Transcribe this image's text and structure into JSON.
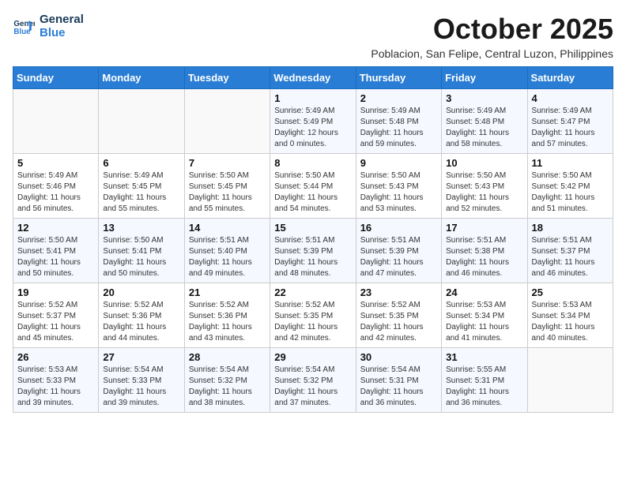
{
  "logo": {
    "line1": "General",
    "line2": "Blue"
  },
  "header": {
    "month_year": "October 2025",
    "location": "Poblacion, San Felipe, Central Luzon, Philippines"
  },
  "weekdays": [
    "Sunday",
    "Monday",
    "Tuesday",
    "Wednesday",
    "Thursday",
    "Friday",
    "Saturday"
  ],
  "weeks": [
    [
      {
        "day": "",
        "info": ""
      },
      {
        "day": "",
        "info": ""
      },
      {
        "day": "",
        "info": ""
      },
      {
        "day": "1",
        "info": "Sunrise: 5:49 AM\nSunset: 5:49 PM\nDaylight: 12 hours\nand 0 minutes."
      },
      {
        "day": "2",
        "info": "Sunrise: 5:49 AM\nSunset: 5:48 PM\nDaylight: 11 hours\nand 59 minutes."
      },
      {
        "day": "3",
        "info": "Sunrise: 5:49 AM\nSunset: 5:48 PM\nDaylight: 11 hours\nand 58 minutes."
      },
      {
        "day": "4",
        "info": "Sunrise: 5:49 AM\nSunset: 5:47 PM\nDaylight: 11 hours\nand 57 minutes."
      }
    ],
    [
      {
        "day": "5",
        "info": "Sunrise: 5:49 AM\nSunset: 5:46 PM\nDaylight: 11 hours\nand 56 minutes."
      },
      {
        "day": "6",
        "info": "Sunrise: 5:49 AM\nSunset: 5:45 PM\nDaylight: 11 hours\nand 55 minutes."
      },
      {
        "day": "7",
        "info": "Sunrise: 5:50 AM\nSunset: 5:45 PM\nDaylight: 11 hours\nand 55 minutes."
      },
      {
        "day": "8",
        "info": "Sunrise: 5:50 AM\nSunset: 5:44 PM\nDaylight: 11 hours\nand 54 minutes."
      },
      {
        "day": "9",
        "info": "Sunrise: 5:50 AM\nSunset: 5:43 PM\nDaylight: 11 hours\nand 53 minutes."
      },
      {
        "day": "10",
        "info": "Sunrise: 5:50 AM\nSunset: 5:43 PM\nDaylight: 11 hours\nand 52 minutes."
      },
      {
        "day": "11",
        "info": "Sunrise: 5:50 AM\nSunset: 5:42 PM\nDaylight: 11 hours\nand 51 minutes."
      }
    ],
    [
      {
        "day": "12",
        "info": "Sunrise: 5:50 AM\nSunset: 5:41 PM\nDaylight: 11 hours\nand 50 minutes."
      },
      {
        "day": "13",
        "info": "Sunrise: 5:50 AM\nSunset: 5:41 PM\nDaylight: 11 hours\nand 50 minutes."
      },
      {
        "day": "14",
        "info": "Sunrise: 5:51 AM\nSunset: 5:40 PM\nDaylight: 11 hours\nand 49 minutes."
      },
      {
        "day": "15",
        "info": "Sunrise: 5:51 AM\nSunset: 5:39 PM\nDaylight: 11 hours\nand 48 minutes."
      },
      {
        "day": "16",
        "info": "Sunrise: 5:51 AM\nSunset: 5:39 PM\nDaylight: 11 hours\nand 47 minutes."
      },
      {
        "day": "17",
        "info": "Sunrise: 5:51 AM\nSunset: 5:38 PM\nDaylight: 11 hours\nand 46 minutes."
      },
      {
        "day": "18",
        "info": "Sunrise: 5:51 AM\nSunset: 5:37 PM\nDaylight: 11 hours\nand 46 minutes."
      }
    ],
    [
      {
        "day": "19",
        "info": "Sunrise: 5:52 AM\nSunset: 5:37 PM\nDaylight: 11 hours\nand 45 minutes."
      },
      {
        "day": "20",
        "info": "Sunrise: 5:52 AM\nSunset: 5:36 PM\nDaylight: 11 hours\nand 44 minutes."
      },
      {
        "day": "21",
        "info": "Sunrise: 5:52 AM\nSunset: 5:36 PM\nDaylight: 11 hours\nand 43 minutes."
      },
      {
        "day": "22",
        "info": "Sunrise: 5:52 AM\nSunset: 5:35 PM\nDaylight: 11 hours\nand 42 minutes."
      },
      {
        "day": "23",
        "info": "Sunrise: 5:52 AM\nSunset: 5:35 PM\nDaylight: 11 hours\nand 42 minutes."
      },
      {
        "day": "24",
        "info": "Sunrise: 5:53 AM\nSunset: 5:34 PM\nDaylight: 11 hours\nand 41 minutes."
      },
      {
        "day": "25",
        "info": "Sunrise: 5:53 AM\nSunset: 5:34 PM\nDaylight: 11 hours\nand 40 minutes."
      }
    ],
    [
      {
        "day": "26",
        "info": "Sunrise: 5:53 AM\nSunset: 5:33 PM\nDaylight: 11 hours\nand 39 minutes."
      },
      {
        "day": "27",
        "info": "Sunrise: 5:54 AM\nSunset: 5:33 PM\nDaylight: 11 hours\nand 39 minutes."
      },
      {
        "day": "28",
        "info": "Sunrise: 5:54 AM\nSunset: 5:32 PM\nDaylight: 11 hours\nand 38 minutes."
      },
      {
        "day": "29",
        "info": "Sunrise: 5:54 AM\nSunset: 5:32 PM\nDaylight: 11 hours\nand 37 minutes."
      },
      {
        "day": "30",
        "info": "Sunrise: 5:54 AM\nSunset: 5:31 PM\nDaylight: 11 hours\nand 36 minutes."
      },
      {
        "day": "31",
        "info": "Sunrise: 5:55 AM\nSunset: 5:31 PM\nDaylight: 11 hours\nand 36 minutes."
      },
      {
        "day": "",
        "info": ""
      }
    ]
  ]
}
